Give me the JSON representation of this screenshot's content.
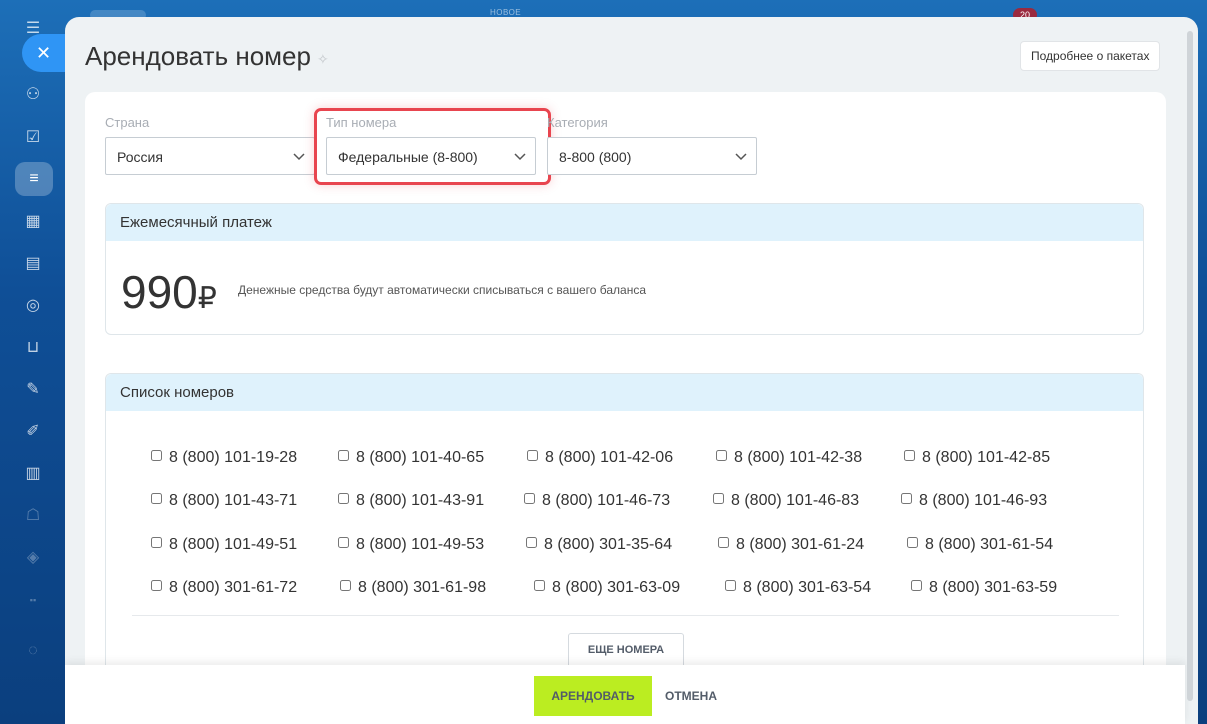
{
  "topbar": {
    "label": "НОВОЕ",
    "badge": "20"
  },
  "rail": {
    "icons": [
      "menu-icon",
      "crm-icon",
      "tasks-icon",
      "filter-icon",
      "calendar-icon",
      "store-icon",
      "target-icon",
      "cart-icon",
      "sign-icon",
      "pen-icon",
      "analytics-icon",
      "robot-icon",
      "cube-icon",
      "apps-icon",
      "settings-icon"
    ]
  },
  "page": {
    "title": "Арендовать номер",
    "more_packages": "Подробнее о пакетах"
  },
  "filters": {
    "country": {
      "label": "Страна",
      "value": "Россия"
    },
    "number_type": {
      "label": "Тип номера",
      "value": "Федеральные (8-800)"
    },
    "category": {
      "label": "Категория",
      "value": "8-800 (800)"
    }
  },
  "payment": {
    "title": "Ежемесячный платеж",
    "amount": "990",
    "currency": "₽",
    "note": "Денежные средства будут автоматически списываться с вашего баланса"
  },
  "numbers": {
    "title": "Список номеров",
    "items": [
      "8 (800) 101-19-28",
      "8 (800) 101-40-65",
      "8 (800) 101-42-06",
      "8 (800) 101-42-38",
      "8 (800) 101-42-85",
      "8 (800) 101-43-71",
      "8 (800) 101-43-91",
      "8 (800) 101-46-73",
      "8 (800) 101-46-83",
      "8 (800) 101-46-93",
      "8 (800) 101-49-51",
      "8 (800) 101-49-53",
      "8 (800) 301-35-64",
      "8 (800) 301-61-24",
      "8 (800) 301-61-54",
      "8 (800) 301-61-72",
      "8 (800) 301-61-98",
      "8 (800) 301-63-09",
      "8 (800) 301-63-54",
      "8 (800) 301-63-59"
    ],
    "more_button": "ЕЩЕ НОМЕРА"
  },
  "footer": {
    "rent": "АРЕНДОВАТЬ",
    "cancel": "ОТМЕНА"
  }
}
